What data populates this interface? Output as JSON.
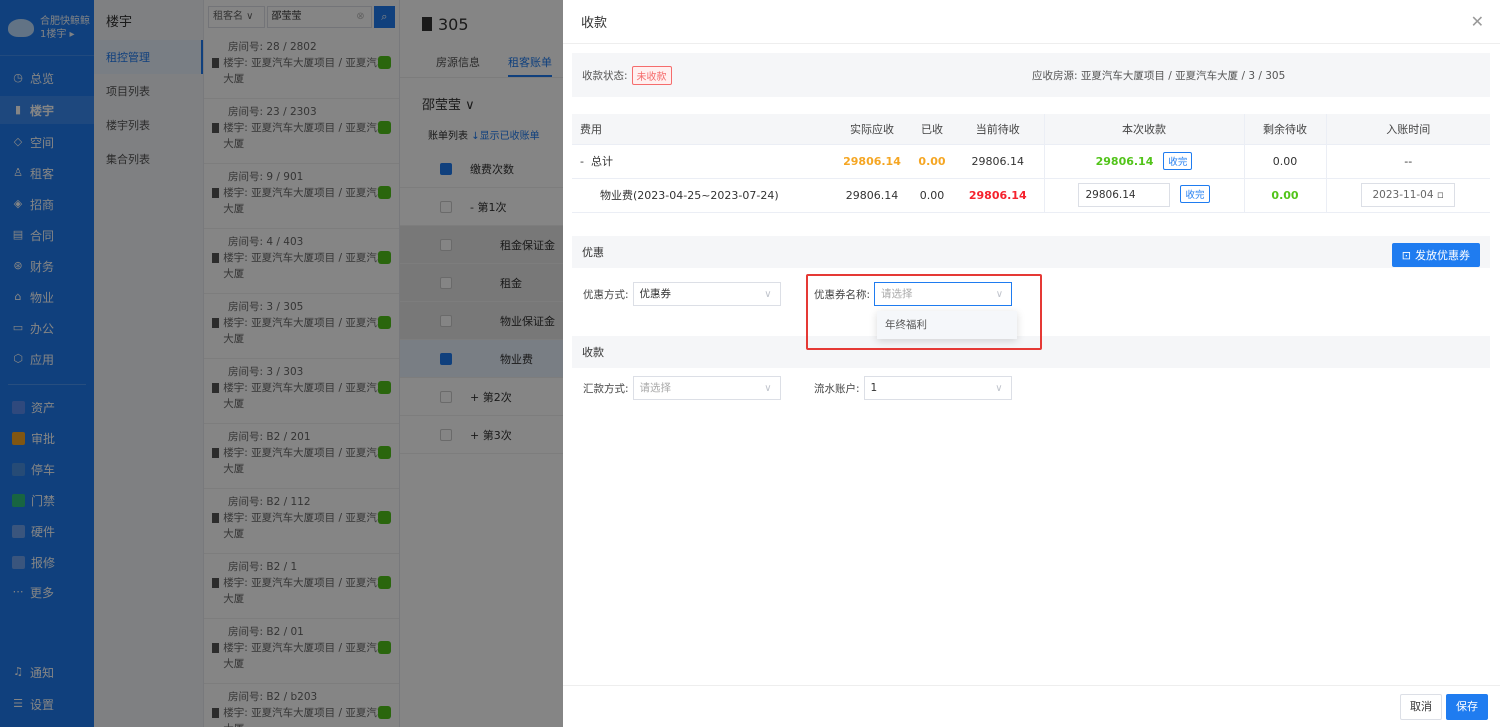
{
  "nav": {
    "company": "合肥快鲸鲸",
    "building": "1楼宇",
    "items": [
      {
        "label": "总览",
        "icon": "dashboard-icon"
      },
      {
        "label": "楼宇",
        "icon": "building-icon"
      },
      {
        "label": "空间",
        "icon": "space-icon"
      },
      {
        "label": "租客",
        "icon": "tenant-icon"
      },
      {
        "label": "招商",
        "icon": "invest-icon"
      },
      {
        "label": "合同",
        "icon": "contract-icon"
      },
      {
        "label": "财务",
        "icon": "finance-icon"
      },
      {
        "label": "物业",
        "icon": "property-icon"
      },
      {
        "label": "办公",
        "icon": "office-icon"
      },
      {
        "label": "应用",
        "icon": "app-icon"
      }
    ],
    "apps": [
      {
        "label": "资产",
        "color": "#5b8def"
      },
      {
        "label": "审批",
        "color": "#f5a623"
      },
      {
        "label": "停车",
        "color": "#4a90e2"
      },
      {
        "label": "门禁",
        "color": "#2ec27e"
      },
      {
        "label": "硬件",
        "color": "#6fa3ef"
      },
      {
        "label": "报修",
        "color": "#6fa3ef"
      }
    ],
    "more": "更多",
    "notify": "通知",
    "settings": "设置"
  },
  "subnav": {
    "title": "楼宇",
    "items": [
      "租控管理",
      "项目列表",
      "楼宇列表",
      "集合列表"
    ]
  },
  "list": {
    "search_type": "租客名",
    "search_value": "邵莹莹",
    "rooms": [
      {
        "room": "房间号: 28 / 2802",
        "building": "楼宇: 亚夏汽车大厦项目 / 亚夏汽车大厦"
      },
      {
        "room": "房间号: 23 / 2303",
        "building": "楼宇: 亚夏汽车大厦项目 / 亚夏汽车大厦"
      },
      {
        "room": "房间号: 9 / 901",
        "building": "楼宇: 亚夏汽车大厦项目 / 亚夏汽车大厦"
      },
      {
        "room": "房间号: 4 / 403",
        "building": "楼宇: 亚夏汽车大厦项目 / 亚夏汽车大厦"
      },
      {
        "room": "房间号: 3 / 305",
        "building": "楼宇: 亚夏汽车大厦项目 / 亚夏汽车大厦"
      },
      {
        "room": "房间号: 3 / 303",
        "building": "楼宇: 亚夏汽车大厦项目 / 亚夏汽车大厦"
      },
      {
        "room": "房间号: B2 / 201",
        "building": "楼宇: 亚夏汽车大厦项目 / 亚夏汽车大厦"
      },
      {
        "room": "房间号: B2 / 112",
        "building": "楼宇: 亚夏汽车大厦项目 / 亚夏汽车大厦"
      },
      {
        "room": "房间号: B2 / 1",
        "building": "楼宇: 亚夏汽车大厦项目 / 亚夏汽车大厦"
      },
      {
        "room": "房间号: B2 / 01",
        "building": "楼宇: 亚夏汽车大厦项目 / 亚夏汽车大厦"
      },
      {
        "room": "房间号: B2 / b203",
        "building": "楼宇: 亚夏汽车大厦项目 / 亚夏汽车大厦"
      }
    ]
  },
  "detail": {
    "room": "305",
    "tabs": [
      "房源信息",
      "租客账单"
    ],
    "tenant": "邵莹莹",
    "list_label": "账单列表",
    "show_paid": "显示已收账单",
    "col_header": "缴费次数",
    "rows": [
      "第1次",
      "租金保证金",
      "租金",
      "物业保证金",
      "物业费",
      "第2次",
      "第3次"
    ]
  },
  "drawer": {
    "title": "收款",
    "status_label": "收款状态:",
    "status_value": "未收款",
    "source_label": "应收房源:",
    "source_value": "亚夏汽车大厦项目 / 亚夏汽车大厦 / 3 / 305",
    "table": {
      "headers": [
        "费用",
        "实际应收",
        "已收",
        "当前待收",
        "本次收款",
        "剩余待收",
        "入账时间"
      ],
      "total": {
        "name": "总计",
        "actual": "29806.14",
        "received": "0.00",
        "pending": "29806.14",
        "this": "29806.14",
        "remain": "0.00",
        "time": "--"
      },
      "item": {
        "name": "物业费(2023-04-25~2023-07-24)",
        "actual": "29806.14",
        "received": "0.00",
        "pending": "29806.14",
        "this": "29806.14",
        "remain": "0.00",
        "time": "2023-11-04"
      },
      "collect_btn": "收完"
    },
    "discount": {
      "title": "优惠",
      "issue_btn": "发放优惠券",
      "method_label": "优惠方式:",
      "method_value": "优惠券",
      "name_label": "优惠券名称:",
      "name_placeholder": "请选择",
      "option": "年终福利"
    },
    "receive": {
      "title": "收款",
      "pay_label": "汇款方式:",
      "pay_placeholder": "请选择",
      "account_label": "流水账户:",
      "account_value": "1"
    },
    "cancel": "取消",
    "save": "保存"
  }
}
